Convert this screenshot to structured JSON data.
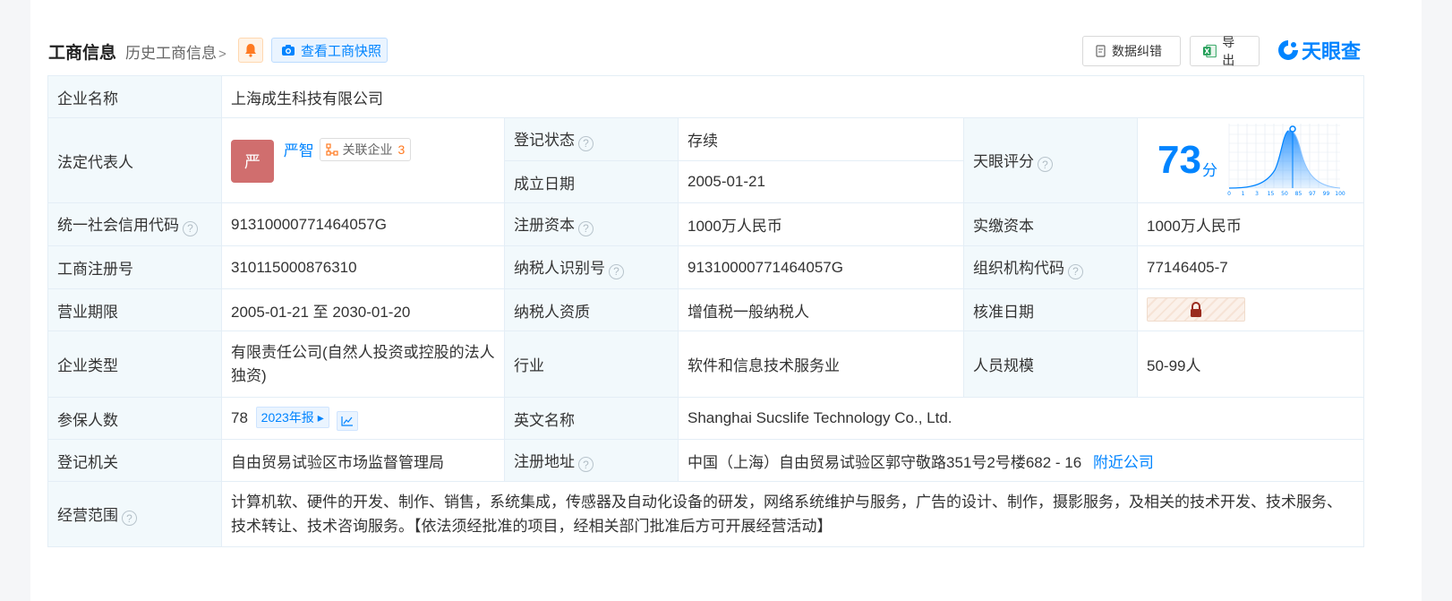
{
  "header": {
    "title": "工商信息",
    "history_link": "历史工商信息",
    "snapshot_button": "查看工商快照",
    "data_fix_button": "数据纠错",
    "export_button": "导出",
    "logo_text": "天眼查"
  },
  "colors": {
    "accent": "#0084ff",
    "label_bg": "#f2f9fc",
    "status_green": "#28a745",
    "avatar": "#d06e6e"
  },
  "labels": {
    "company_name": "企业名称",
    "legal_rep": "法定代表人",
    "reg_status": "登记状态",
    "founded": "成立日期",
    "tianyan_score": "天眼评分",
    "credit_code": "统一社会信用代码",
    "reg_capital": "注册资本",
    "paid_capital": "实缴资本",
    "reg_no": "工商注册号",
    "taxpayer_id": "纳税人识别号",
    "org_code": "组织机构代码",
    "term": "营业期限",
    "taxpayer_qual": "纳税人资质",
    "approval_date": "核准日期",
    "company_type": "企业类型",
    "industry": "行业",
    "staff_size": "人员规模",
    "insured": "参保人数",
    "english_name": "英文名称",
    "reg_authority": "登记机关",
    "reg_address": "注册地址",
    "business_scope": "经营范围"
  },
  "values": {
    "company_name": "上海成生科技有限公司",
    "legal_rep_avatar": "严",
    "legal_rep_name": "严智",
    "related_label": "关联企业",
    "related_count": "3",
    "reg_status": "存续",
    "founded": "2005-01-21",
    "score": "73",
    "score_unit": "分",
    "credit_code": "91310000771464057G",
    "reg_capital": "1000万人民币",
    "paid_capital": "1000万人民币",
    "reg_no": "310115000876310",
    "taxpayer_id": "91310000771464057G",
    "org_code": "77146405-7",
    "term": "2005-01-21 至 2030-01-20",
    "taxpayer_qual": "增值税一般纳税人",
    "company_type": "有限责任公司(自然人投资或控股的法人独资)",
    "industry": "软件和信息技术服务业",
    "staff_size": "50-99人",
    "insured": "78",
    "annual_report": "2023年报",
    "english_name": "Shanghai Sucslife Technology Co., Ltd.",
    "reg_authority": "自由贸易试验区市场监督管理局",
    "reg_address": "中国（上海）自由贸易试验区郭守敬路351号2号楼682 - 16",
    "nearby_link": "附近公司",
    "business_scope": "计算机软、硬件的开发、制作、销售，系统集成，传感器及自动化设备的研发，网络系统维护与服务，广告的设计、制作，摄影服务，及相关的技术开发、技术服务、技术转让、技术咨询服务。【依法须经批准的项目，经相关部门批准后方可开展经营活动】"
  },
  "score_chart_ticks": [
    "0",
    "1",
    "3",
    "15",
    "50",
    "85",
    "97",
    "99",
    "100"
  ],
  "icons": [
    "bell-icon",
    "camera-icon",
    "document-fix-icon",
    "excel-icon",
    "tianyancha-logo-icon",
    "related-company-icon",
    "question-icon",
    "lock-icon",
    "trend-chart-icon"
  ]
}
